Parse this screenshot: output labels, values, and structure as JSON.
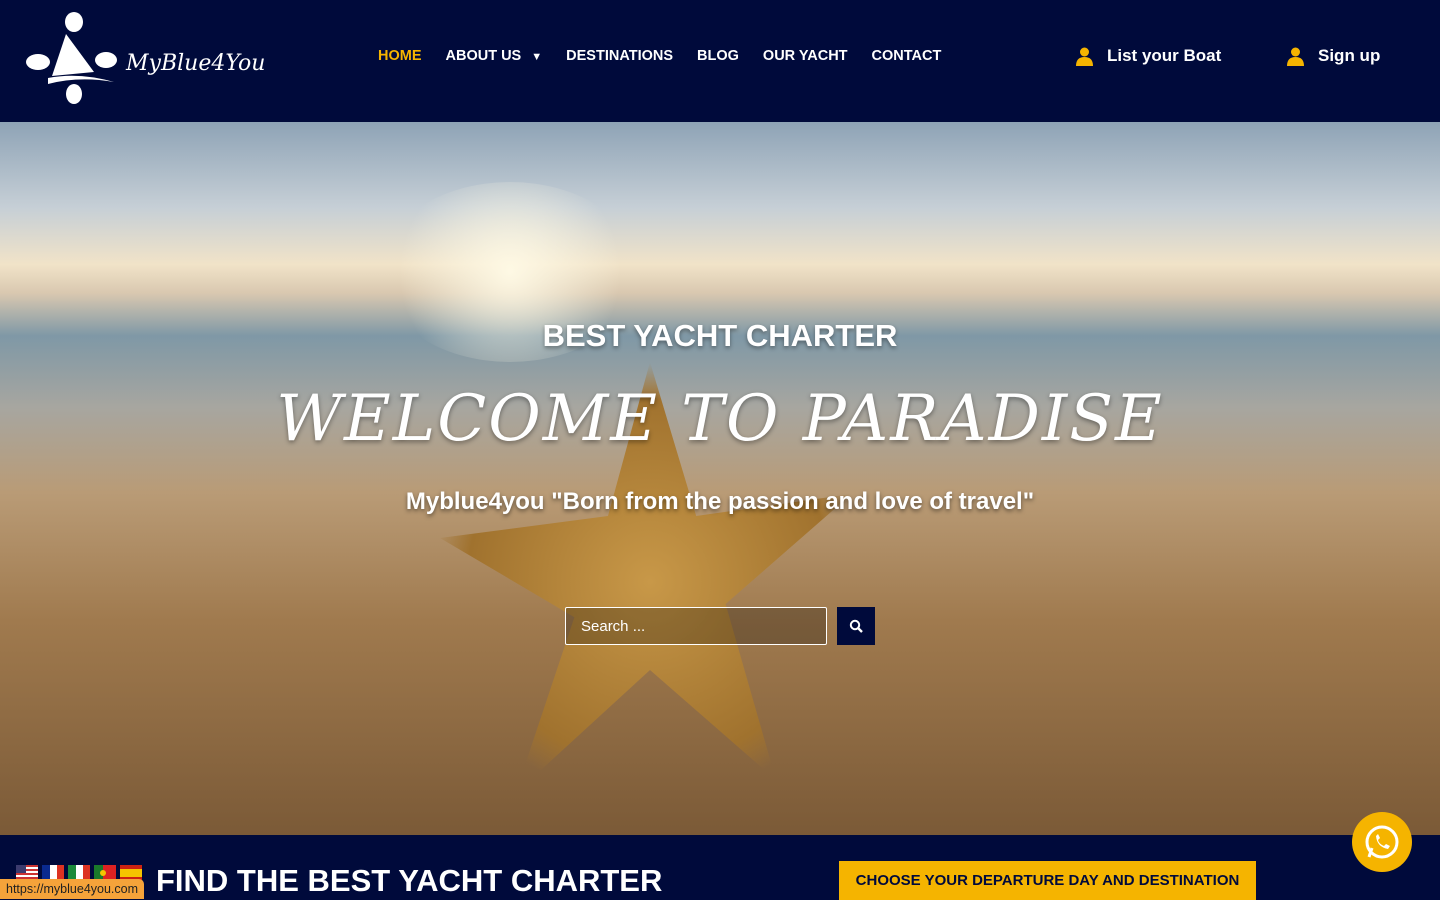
{
  "brand": {
    "name": "MyBlue4You"
  },
  "nav": {
    "items": [
      {
        "label": "HOME",
        "active": true
      },
      {
        "label": "ABOUT US"
      },
      {
        "label": "DESTINATIONS"
      },
      {
        "label": "BLOG"
      },
      {
        "label": "OUR YACHT"
      },
      {
        "label": "CONTACT"
      }
    ]
  },
  "header": {
    "list_boat": "List your Boat",
    "sign_up": "Sign up"
  },
  "hero": {
    "subtitle": "BEST YACHT CHARTER",
    "title": "WELCOME TO PARADISE",
    "tagline": "Myblue4you \"Born from the passion and love of travel\"",
    "search_placeholder": "Search ..."
  },
  "bottom": {
    "heading": "FIND THE BEST YACHT CHARTER",
    "cta": "CHOOSE YOUR DEPARTURE DAY AND DESTINATION",
    "languages": [
      "en",
      "fr",
      "it",
      "pt",
      "es"
    ]
  },
  "status_url": "https://myblue4you.com",
  "colors": {
    "navy": "#000a3b",
    "accent": "#f5b400"
  }
}
